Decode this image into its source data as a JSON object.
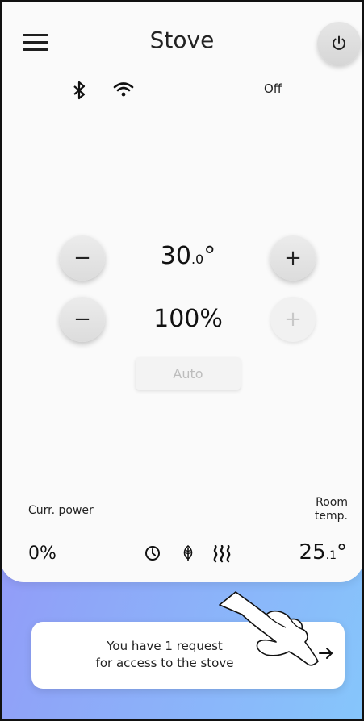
{
  "header": {
    "title": "Stove"
  },
  "status": {
    "text": "Off"
  },
  "temperature": {
    "main": "30",
    "decimal": ".0",
    "unit": "°"
  },
  "power_level": {
    "value": "100%"
  },
  "controls": {
    "minus": "−",
    "plus": "+",
    "auto_label": "Auto"
  },
  "footer": {
    "curr_power_label": "Curr. power",
    "room_temp_label_1": "Room",
    "room_temp_label_2": "temp.",
    "curr_power_value": "0%",
    "room_temp_main": "25",
    "room_temp_decimal": ".1",
    "room_temp_unit": "°"
  },
  "notification": {
    "line1": "You have 1 request",
    "line2": "for access to the stove"
  },
  "icons": [
    "menu-icon",
    "power-icon",
    "bluetooth-icon",
    "wifi-icon",
    "minus-icon",
    "plus-icon",
    "clock-icon",
    "leaf-icon",
    "heat-icon",
    "arrow-right-icon",
    "hand-gesture-icon"
  ],
  "colors": {
    "background_start": "#9b86f7",
    "background_end": "#86c6fb",
    "card": "#fafafa"
  }
}
